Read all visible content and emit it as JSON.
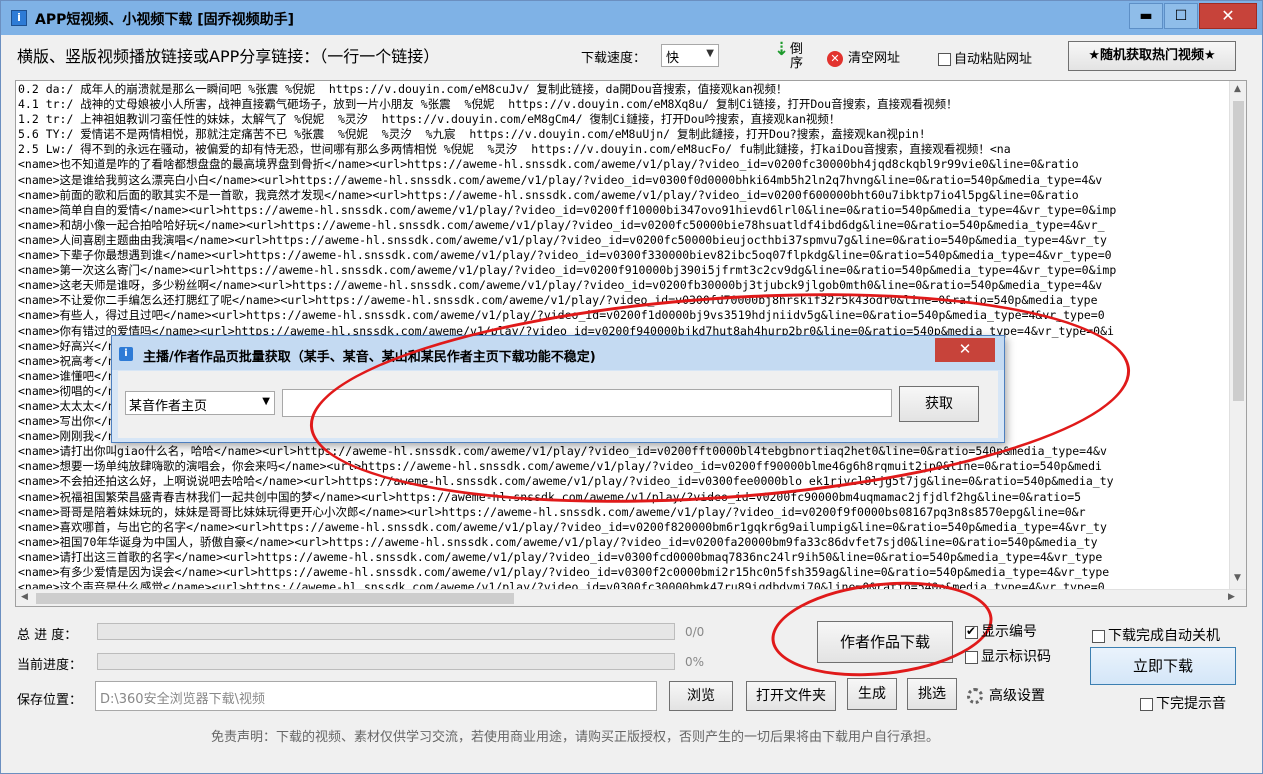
{
  "window": {
    "title": "APP短视频、小视频下载 [固乔视频助手]",
    "min": "▬",
    "max": "☐",
    "close": "✕"
  },
  "toolbar": {
    "prompt": "横版、竖版视频播放链接或APP分享链接：（一行一个链接）",
    "speed_label": "下载速度：",
    "speed_value": "快",
    "reverse_label": "倒序",
    "clear_label": "清空网址",
    "autopaste_label": "自动粘贴网址",
    "hot_button": "★随机获取热门视频★"
  },
  "links": [
    "0.2 da:/ 成年人的崩溃就是那么一瞬间吧 %张震 %倪妮  https://v.douyin.com/eM8cuJv/ 复制此链接，da開Dou音搜索，值接观kan视频！",
    "4.1 tr:/ 战神的丈母娘被小人所害，战神直接霸气砸场子，放到一片小朋友 %张震  %倪妮  https://v.douyin.com/eM8Xq8u/ 复制Ci链接，打开Dou音搜索，直接观看视频！",
    "1.2 tr:/ 上神祖姐教训刁蛮任性的妹妹，太解气了 %倪妮  %灵汐  https://v.douyin.com/eM8gCm4/ 復制Ci鏈接，打开Dou吟搜索，直接观kan视频！",
    "5.6 TY:/ 爱情诺不是两情相悦，那就注定痛苦不已 %张震  %倪妮  %灵汐  %九宸  https://v.douyin.com/eM8uUjn/ 复制此鏈接，打开Dou?搜索，盍接观kan视pin!",
    "2.5 Lw:/ 得不到的永远在骚动，被偏爱的却有恃无恐，世间哪有那么多两情相悦 %倪妮  %灵汐  https://v.douyin.com/eM8ucFo/ fu制此鏈接，打kaiDou音搜索，直接观看视频！<na",
    "<name>也不知道是咋的了看啥都想盘盘的最高境界盘到骨折</name><url>https://aweme-hl.snssdk.com/aweme/v1/play/?video_id=v0200fc30000bh4jqd8ckqbl9r99vie0&line=0&ratio",
    "<name>这是谁给我剪这么漂亮白小白</name><url>https://aweme-hl.snssdk.com/aweme/v1/play/?video_id=v0300f0d0000bhki64mb5h2ln2q7hvng&line=0&ratio=540p&media_type=4&v",
    "<name>前面的歌和后面的歌其实不是一首歌，我竟然才发现</name><url>https://aweme-hl.snssdk.com/aweme/v1/play/?video_id=v0200f600000bht60u7ibktp7io4l5pg&line=0&ratio",
    "<name>简单自自的爱情</name><url>https://aweme-hl.snssdk.com/aweme/v1/play/?video_id=v0200ff10000bi347ovo91hievd6lrl0&line=0&ratio=540p&media_type=4&vr_type=0&imp",
    "<name>和胡小像一起合拍哈哈好玩</name><url>https://aweme-hl.snssdk.com/aweme/v1/play/?video_id=v0200fc50000bie78hsuatldf4ibd6dg&line=0&ratio=540p&media_type=4&vr_",
    "<name>人间喜剧主题曲由我演唱</name><url>https://aweme-hl.snssdk.com/aweme/v1/play/?video_id=v0200fc50000bieujocthbi37spmvu7g&line=0&ratio=540p&media_type=4&vr_ty",
    "<name>下辈子你最想遇到谁</name><url>https://aweme-hl.snssdk.com/aweme/v1/play/?video_id=v0300f330000biev82ibc5oq07flpkdg&line=0&ratio=540p&media_type=4&vr_type=0",
    "<name>第一次这么寄门</name><url>https://aweme-hl.snssdk.com/aweme/v1/play/?video_id=v0200f910000bj390i5jfrmt3c2cv9dg&line=0&ratio=540p&media_type=4&vr_type=0&imp",
    "<name>这老天师是谁呀，多少粉丝啊</name><url>https://aweme-hl.snssdk.com/aweme/v1/play/?video_id=v0200fb30000bj3tjubck9jlgob0mth0&line=0&ratio=540p&media_type=4&v",
    "<name>不让爱你二手编怎么还打腮红了呢</name><url>https://aweme-hl.snssdk.com/aweme/v1/play/?video_id=v0300fd70000bj8hrskif32r5k43odr0&line=0&ratio=540p&media_type",
    "<name>有些人，得过且过吧</name><url>https://aweme-hl.snssdk.com/aweme/v1/play/?video_id=v0200f1d0000bj9vs3519hdjniidv5g&line=0&ratio=540p&media_type=4&vr_type=0",
    "<name>你有错过的爱情吗</name><url>https://aweme-hl.snssdk.com/aweme/v1/play/?video_id=v0200f940000bjkd7hut8ah4hurp2br0&line=0&ratio=540p&media_type=4&vr_type=0&i",
    "<name>好高兴</name><url>https://aweme-hl.snssdk.com/aweme/v1/play/?video_id=v0200f9d0000bjkt2n39hrst7p2sqn5g&line=0&ratio=540p&media_type=4&vr",
    "<name>祝高考</name><url>https://aweme-hl.snssdk.com/aweme/v1/play/?video_id=v0200f4a0000bjl1ohmo8fvl4p3oe9qr972u&line=0&ratio=540p&m",
    "<name>谁懂吧</name><url>https://aweme-hl.snssdk.com/aweme/v1/play/?video_id=v0200fa10000bjlqpr5h8kopp2r0&line=0&ratio=540p&media_type",
    "<name>彻唱的</name><url>https://aweme-hl.snssdk.com/aweme/v1/play/?video_id=v0300fc10000bjmn3c5k2ggqp4h0&line=0&ratio=540p&media_type",
    "<name>太太太</name><url>https://aweme-hl.snssdk.com/aweme/v1/play/?video_id=v0200f230000bjn8s7v2edr0kp3q&line=0&ratio=540p&media_type",
    "<name>写出你</name><url>https://aweme-hl.snssdk.com/aweme/v1/play/?video_id=v0200fe50000bjo2cq1gb2pf9a8s&line=0&ratio=540p&media_type=4&v",
    "<name>刚刚我</name><url>https://aweme-hl.snssdk.com/aweme/v1/play/?video_id=v0200f1f0000bjp0t3p2ah7jug&line=0&ratio=540p&medi",
    "<name>请打出你叫giao什么名，哈哈</name><url>https://aweme-hl.snssdk.com/aweme/v1/play/?video_id=v0200fft0000bl4tebgbnortiaq2het0&line=0&ratio=540p&media_type=4&v",
    "<name>想要一场单纯放肆嗨歌的演唱会，你会来吗</name><url>https://aweme-hl.snssdk.com/aweme/v1/play/?video_id=v0200ff90000blme46g6h8rqmuit2jp0&line=0&ratio=540p&medi",
    "<name>不会拍还拍这么好，上啊说说吧去哈哈</name><url>https://aweme-hl.snssdk.com/aweme/v1/play/?video_id=v0300fee0000blo ek1rjvcl8ljg5t7jg&line=0&ratio=540p&media_ty",
    "<name>祝福祖国繁荣昌盛青春吉林我们一起共创中国的梦</name><url>https://aweme-hl.snssdk.com/aweme/v1/play/?video_id=v0200fc90000bm4uqmamac2jfjdlf2hg&line=0&ratio=5",
    "<name>哥哥是陪着妹妹玩的，妹妹是哥哥比妹妹玩得更开心小次郎</name><url>https://aweme-hl.snssdk.com/aweme/v1/play/?video_id=v0200f9f0000bs08167pq3n8s8570epg&line=0&r",
    "<name>喜欢哪首，与出它的名字</name><url>https://aweme-hl.snssdk.com/aweme/v1/play/?video_id=v0200f820000bm6r1gqkr6g9ailumpig&line=0&ratio=540p&media_type=4&vr_ty",
    "<name>祖国70年华诞身为中国人，骄傲自豪</name><url>https://aweme-hl.snssdk.com/aweme/v1/play/?video_id=v0200fa20000bm9fa33c86dvfet7sjd0&line=0&ratio=540p&media_ty",
    "<name>请打出这三首歌的名字</name><url>https://aweme-hl.snssdk.com/aweme/v1/play/?video_id=v0300fcd0000bmaq7836nc24lr9ih50&line=0&ratio=540p&media_type=4&vr_type",
    "<name>有多少爱情是因为误会</name><url>https://aweme-hl.snssdk.com/aweme/v1/play/?video_id=v0300f2c0000bmi2r15hc0n5fsh359ag&line=0&ratio=540p&media_type=4&vr_type",
    "<name>这个声音是什么感觉</name><url>https://aweme-hl.snssdk.com/aweme/v1/play/?video_id=v0300fc30000bmk47ru89iqdbdvmi70&line=0&ratio=540p&media_type=4&vr_type=0"
  ],
  "dialog": {
    "title": "主播/作者作品页批量获取（某手、某音、某山和某民作者主页下载功能不稳定)",
    "close": "✕",
    "source_value": "某音作者主页",
    "input_value": "",
    "fetch_label": "获取"
  },
  "progress": {
    "total_label": "总 进 度：",
    "total_text": "0/0",
    "total_fraction": 0,
    "current_label": "当前进度：",
    "current_text": "0%",
    "current_fraction": 0
  },
  "save": {
    "label": "保存位置：",
    "path": "D:\\360安全浏览器下载\\视频",
    "browse": "浏览",
    "open_folder": "打开文件夹",
    "generate": "生成",
    "filter": "挑选",
    "advanced": "高级设置"
  },
  "actions": {
    "author_download": "作者作品下载",
    "show_number": "显示编号",
    "show_id": "显示标识码",
    "auto_shutdown": "下载完成自动关机",
    "download_now": "立即下载",
    "done_sound": "下完提示音"
  },
  "disclaimer": "免责声明：下载的视频、素材仅供学习交流，若使用商业用途，请购买正版授权，否则产生的一切后果将由下载用户自行承担。",
  "colors": {
    "titlebar": "#7fb2e6",
    "annotation": "#e01a1a",
    "close": "#c7433a"
  }
}
